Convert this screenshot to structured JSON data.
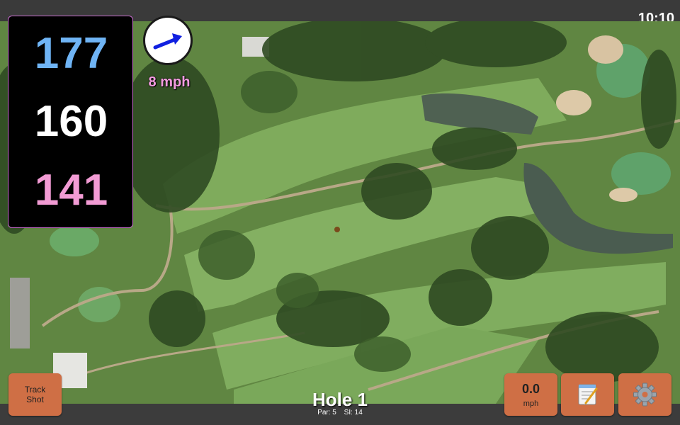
{
  "status_bar": {
    "time": "10:10"
  },
  "distances": {
    "back": "177",
    "middle": "160",
    "front": "141"
  },
  "wind": {
    "speed": "8 mph",
    "direction_icon": "arrow-east-icon"
  },
  "hole": {
    "title": "Hole 1",
    "par_label": "Par: 5",
    "si_label": "SI: 14"
  },
  "buttons": {
    "track_shot_line1": "Track",
    "track_shot_line2": "Shot",
    "speed_value": "0.0",
    "speed_unit": "mph",
    "notes_icon": "notepad-icon",
    "settings_icon": "gear-icon"
  },
  "colors": {
    "back_distance": "#6fb4f5",
    "middle_distance": "#ffffff",
    "front_distance": "#f29bd4",
    "button": "#cf6f45",
    "wind_text": "#f39be0"
  }
}
